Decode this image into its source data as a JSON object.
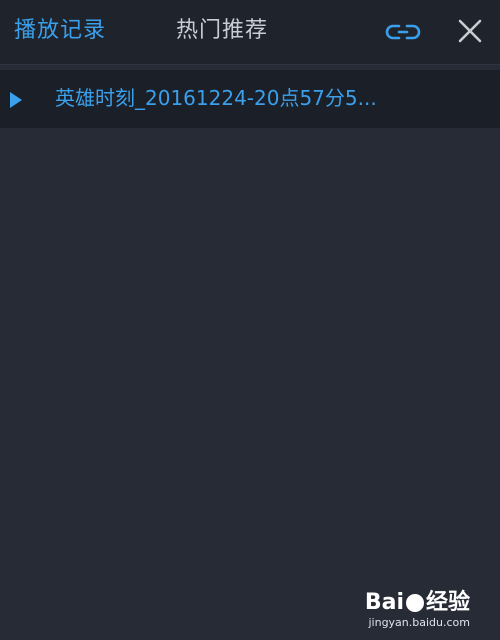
{
  "header": {
    "tabs": [
      {
        "label": "播放记录",
        "active": true
      },
      {
        "label": "热门推荐",
        "active": false
      }
    ],
    "link_icon": "link-icon",
    "close_icon": "close-icon"
  },
  "history": {
    "items": [
      {
        "title": "英雄时刻_20161224-20点57分5...",
        "icon": "play-arrow-icon"
      }
    ]
  },
  "watermark": {
    "logo_text": "Bai",
    "logo_suffix": "经验",
    "url": "jingyan.baidu.com"
  },
  "colors": {
    "accent": "#3aa0ec",
    "background": "#262b36",
    "header": "#1f232c",
    "row": "#1b1f27",
    "muted_text": "#c9ccd2"
  }
}
